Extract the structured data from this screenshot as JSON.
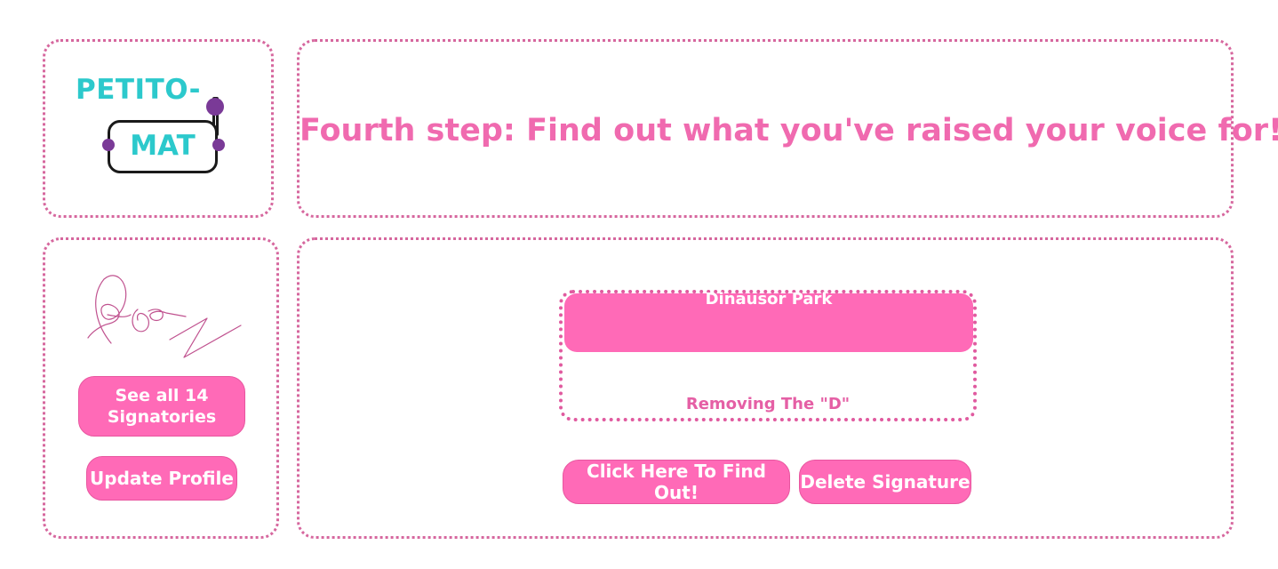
{
  "logo": {
    "line1": "PETITO-",
    "line2": "MAT"
  },
  "header": {
    "title": "Fourth step: Find out what you've raised your voice for!"
  },
  "sidebar": {
    "see_all_label": "See all 14 Signatories",
    "update_profile_label": "Update Profile"
  },
  "petition": {
    "title": "Dinausor Park",
    "description": "Removing The \"D\""
  },
  "actions": {
    "find_out_label": "Click Here To Find Out!",
    "delete_label": "Delete Signature"
  },
  "colors": {
    "accent_pink": "#ff6ab7",
    "title_pink": "#f06aaf",
    "border_pink": "#d6679e",
    "logo_teal": "#2cc9cc",
    "logo_purple": "#7a3a97"
  },
  "icons": {
    "logo": "slot-machine-logo",
    "signature": "signature-drawing"
  }
}
